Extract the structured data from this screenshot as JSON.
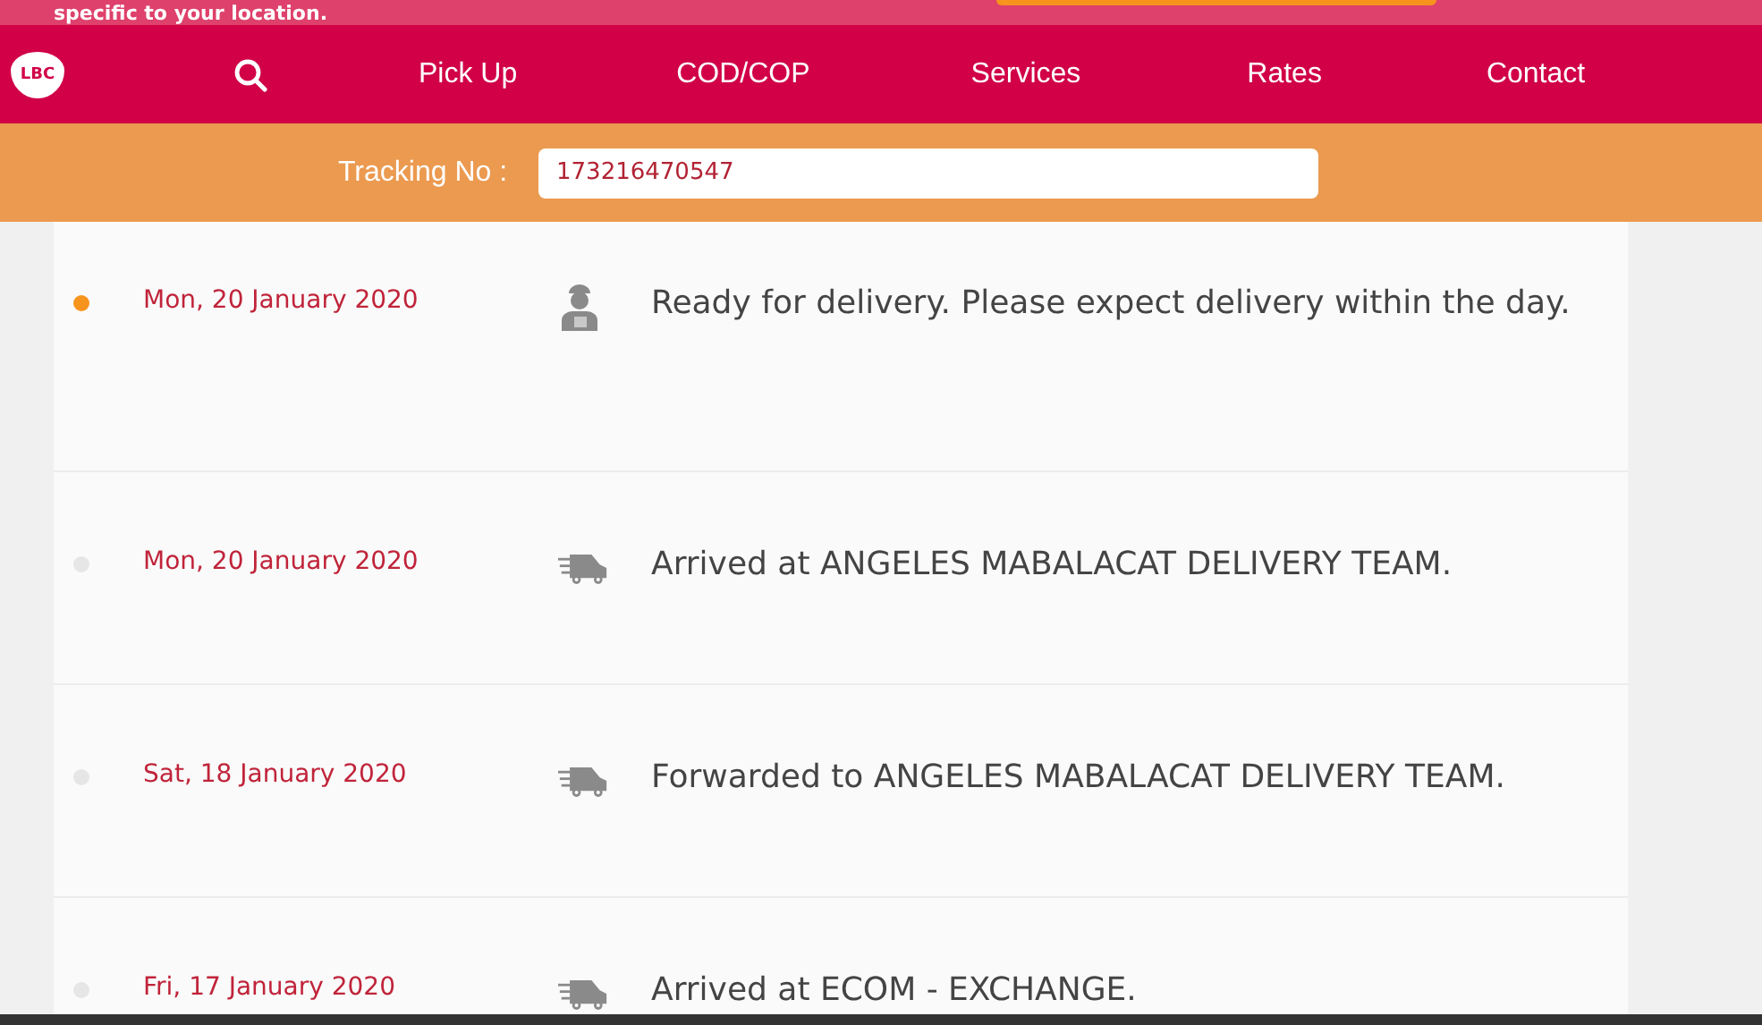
{
  "promo_banner": {
    "text": "specific to your location."
  },
  "nav": {
    "items": [
      {
        "kind": "logo",
        "label": "LBC"
      },
      {
        "kind": "search"
      },
      {
        "kind": "link",
        "label": "Pick Up"
      },
      {
        "kind": "link",
        "label": "COD/COP"
      },
      {
        "kind": "link",
        "label": "Services"
      },
      {
        "kind": "link",
        "label": "Rates"
      },
      {
        "kind": "link",
        "label": "Contact"
      }
    ]
  },
  "tracking": {
    "label": "Tracking No :",
    "value": "173216470547"
  },
  "events": [
    {
      "date": "Mon, 20 January 2020",
      "kind": "courier",
      "current": true,
      "text": "Ready for delivery. Please expect delivery within the day."
    },
    {
      "date": "Mon, 20 January 2020",
      "kind": "truck",
      "current": false,
      "text": "Arrived at ANGELES MABALACAT DELIVERY TEAM."
    },
    {
      "date": "Sat, 18 January 2020",
      "kind": "truck",
      "current": false,
      "text": "Forwarded to ANGELES MABALACAT DELIVERY TEAM."
    },
    {
      "date": "Fri, 17 January 2020",
      "kind": "truck",
      "current": false,
      "text": "Arrived at ECOM - EXCHANGE."
    }
  ]
}
